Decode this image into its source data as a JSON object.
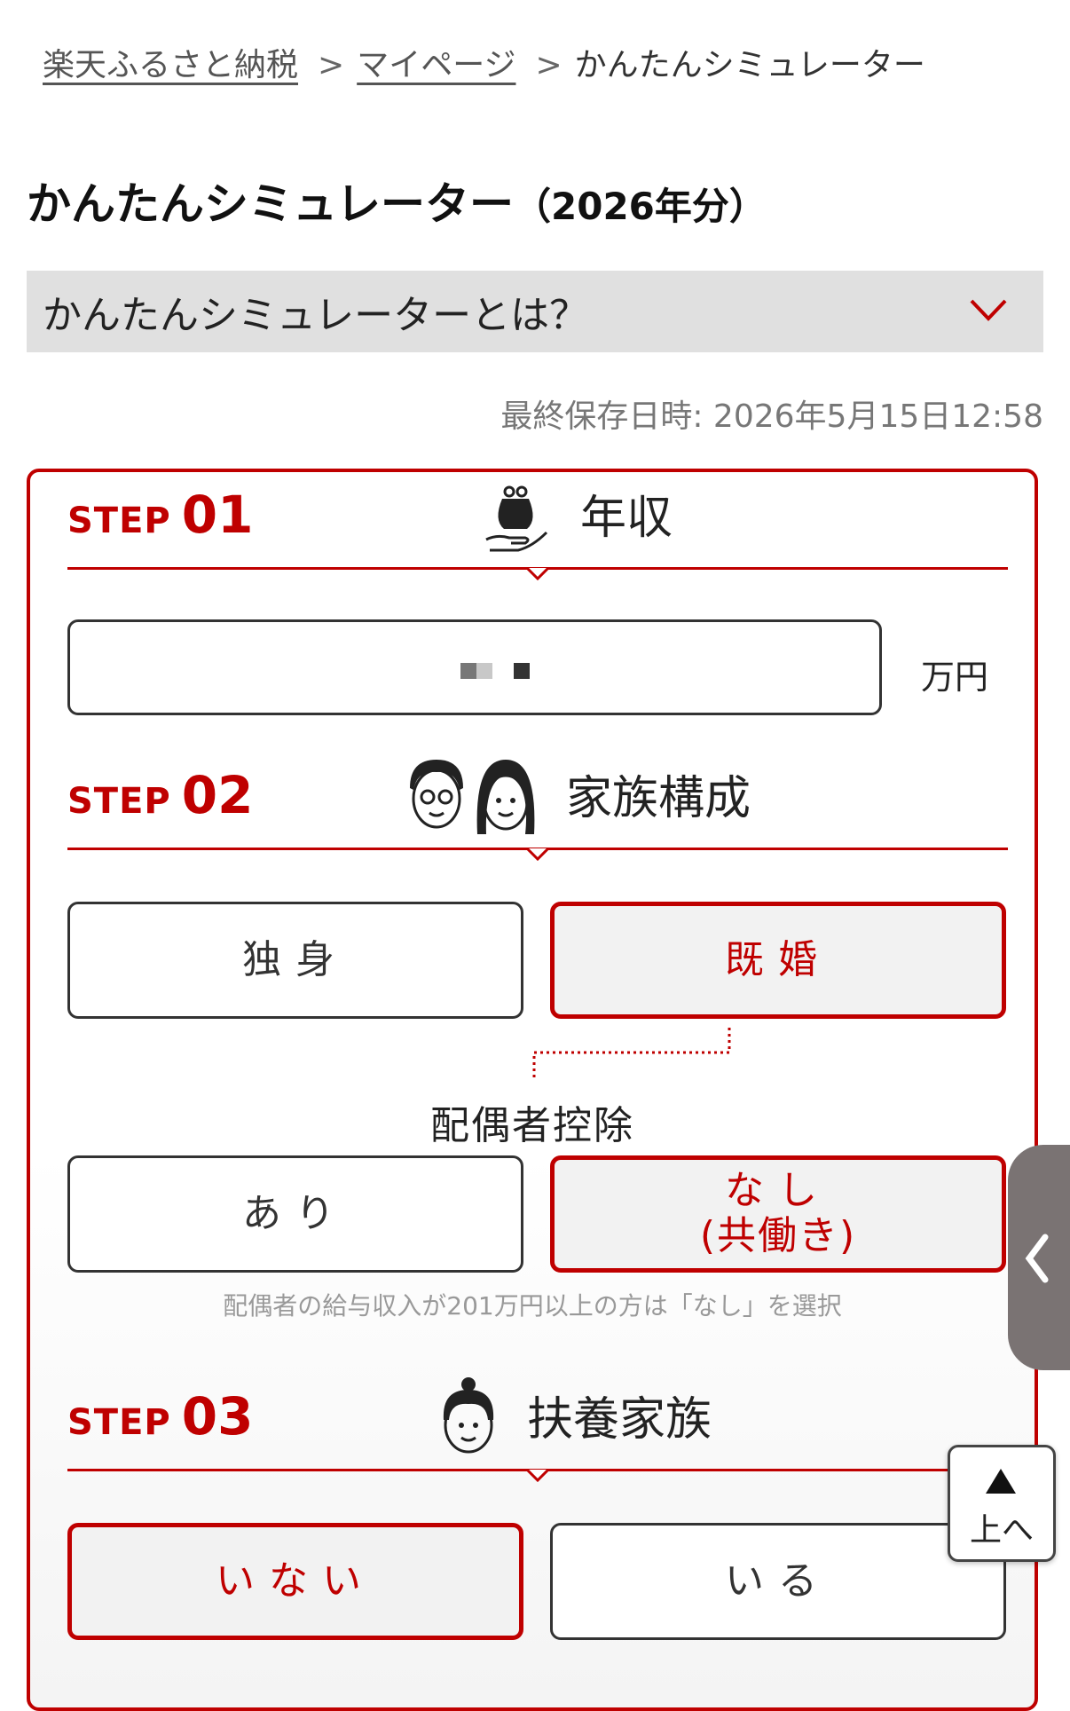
{
  "breadcrumb": {
    "items": [
      "楽天ふるさと納税",
      "マイページ"
    ],
    "separator": ">",
    "current": "かんたんシミュレーター"
  },
  "page": {
    "title": "かんたんシミュレーター",
    "year_suffix": "（2026年分）"
  },
  "accordion": {
    "label": "かんたんシミュレーターとは？"
  },
  "saved": {
    "text": "最終保存日時: 2026年5月15日12:58"
  },
  "steps": [
    {
      "word": "STEP",
      "number": "01",
      "title": "年収",
      "icon": "wallet-hand-icon"
    },
    {
      "word": "STEP",
      "number": "02",
      "title": "家族構成",
      "icon": "couple-icon"
    },
    {
      "word": "STEP",
      "number": "03",
      "title": "扶養家族",
      "icon": "child-icon"
    }
  ],
  "income": {
    "unit": "万円"
  },
  "family": {
    "single": "独身",
    "married": "既婚",
    "selected": "既婚"
  },
  "spouse_deduction": {
    "label": "配偶者控除",
    "yes": "あり",
    "no_line1": "なし",
    "no_line2": "(共働き)",
    "selected": "なし",
    "note": "配偶者の給与収入が201万円以上の方は「なし」を選択"
  },
  "dependents": {
    "none": "いない",
    "some": "いる",
    "selected": "いない"
  },
  "to_top": {
    "label": "上へ"
  },
  "colors": {
    "accent": "#bf0000",
    "selected_bg": "#f2f2f2"
  }
}
